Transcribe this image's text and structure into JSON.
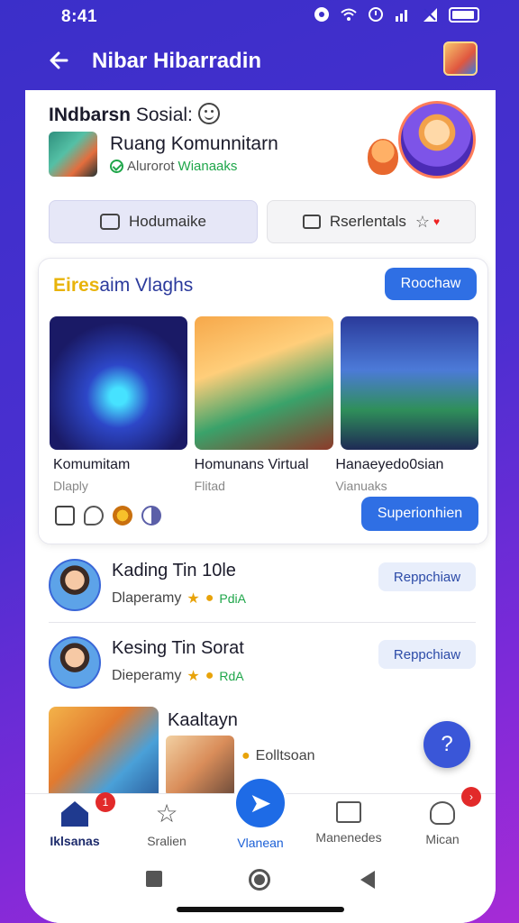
{
  "status": {
    "time": "8:41"
  },
  "appbar": {
    "title": "Nibar Hibarradin"
  },
  "header": {
    "title_bold": "INdbarsn",
    "title_light": "Sosial:",
    "community_name": "Ruang Komunnitarn",
    "community_sub_gray": "Alurorot",
    "community_sub_green": "Wianaaks"
  },
  "tabs": [
    {
      "label": "Hodumaike"
    },
    {
      "label": "Rserlentals"
    }
  ],
  "card": {
    "title_yellow": "Eires",
    "title_rest": "aim Vlaghs",
    "top_button": "Roochaw",
    "tiles": [
      {
        "title": "Komumitam",
        "sub": "Dlaply"
      },
      {
        "title": "Homunans Virtual",
        "sub": "Flitad"
      },
      {
        "title": "Hanaeyedo0sian",
        "sub": "Vianuaks"
      }
    ],
    "bottom_button": "Superionhien"
  },
  "rows": [
    {
      "title": "Kading Tin 10le",
      "sub": "Dlaperamy",
      "tag": "PdiA",
      "button": "Reppchiaw"
    },
    {
      "title": "Kesing Tin Sorat",
      "sub": "Dieperamy",
      "tag": "RdA",
      "button": "Reppchiaw"
    }
  ],
  "row3": {
    "title": "Kaaltayn",
    "sub": "Eolltsoan"
  },
  "fab": {
    "label": "?"
  },
  "bottomnav": [
    {
      "label": "Iklsanas"
    },
    {
      "label": "Sralien"
    },
    {
      "label": "Vlanean"
    },
    {
      "label": "Manenedes"
    },
    {
      "label": "Mican"
    }
  ],
  "badges": {
    "home": "1",
    "user": "›"
  },
  "colors": {
    "accent": "#2f6fe4",
    "header_bg": "#3b2fc9",
    "success": "#1fa64a",
    "badge": "#e22a2a"
  }
}
